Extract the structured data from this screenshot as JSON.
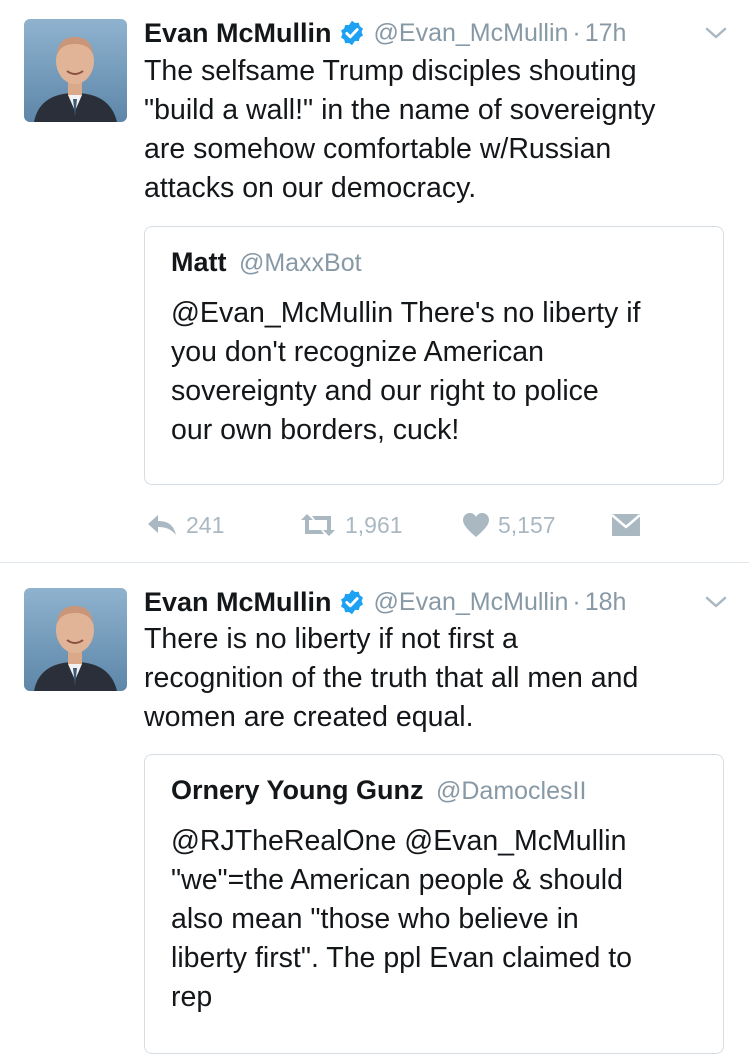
{
  "tweets": [
    {
      "author": {
        "name": "Evan McMullin",
        "handle": "@Evan_McMullin",
        "verified": true
      },
      "separator": "·",
      "time": "17h",
      "text": "The selfsame Trump disciples shouting\n\"build a wall!\" in the name of sovereignty\nare somehow comfortable w/Russian\nattacks on our democracy.",
      "quoted": {
        "name": "Matt",
        "handle": "@MaxxBot",
        "text": "@Evan_McMullin There's no liberty if\nyou don't recognize American\nsovereignty and our right to police\nour own borders, cuck!"
      },
      "actions": {
        "replies": "241",
        "retweets": "1,961",
        "likes": "5,157"
      }
    },
    {
      "author": {
        "name": "Evan McMullin",
        "handle": "@Evan_McMullin",
        "verified": true
      },
      "separator": "·",
      "time": "18h",
      "text": "There is no liberty if not first a\nrecognition of the truth that all men and\nwomen are created equal.",
      "quoted": {
        "name": "Ornery Young Gunz",
        "handle": "@DamoclesII",
        "text": "@RJTheRealOne @Evan_McMullin\n\"we\"=the American people & should\nalso mean \"those who believe in\nliberty first\". The ppl Evan claimed to\nrep"
      }
    }
  ],
  "colors": {
    "text": "#14171a",
    "muted": "#8899a6",
    "icon": "#aab8c2",
    "verified": "#1da1f2",
    "border": "#e1e8ed"
  },
  "icons": [
    "reply-icon",
    "retweet-icon",
    "like-icon",
    "direct-message-icon",
    "verified-badge-icon",
    "chevron-down-icon"
  ]
}
